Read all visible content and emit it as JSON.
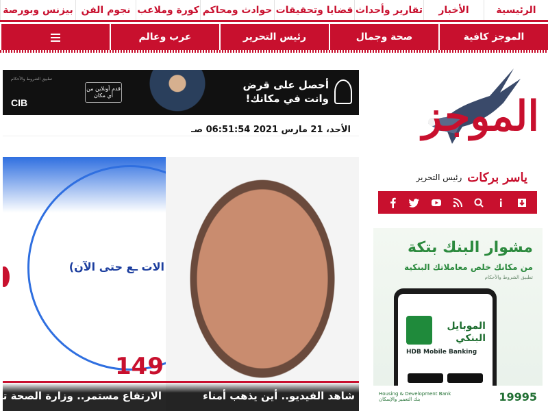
{
  "nav": {
    "row1": [
      {
        "label": "الرئيسية"
      },
      {
        "label": "الأخبار"
      },
      {
        "label": "تقارير وأحداث"
      },
      {
        "label": "قضايا وتحقيقات"
      },
      {
        "label": "حوادث ومحاكم"
      },
      {
        "label": "كورة وملاعب"
      },
      {
        "label": "نجوم الفن"
      },
      {
        "label": "بيزنس وبورصة"
      }
    ],
    "row2": [
      {
        "label": "الموجز كافية"
      },
      {
        "label": "صحة وجمال"
      },
      {
        "label": "رئيس التحرير"
      },
      {
        "label": "عرب وعالم"
      },
      {
        "label": ""
      }
    ]
  },
  "brand": {
    "logo_text": "الموجز",
    "editor_label": "رئيس التحرير",
    "editor_name": "ياسر بركات",
    "accent_color": "#c8102e"
  },
  "social": {
    "icons": [
      "archive-icon",
      "info-icon",
      "search-icon",
      "rss-icon",
      "youtube-icon",
      "twitter-icon",
      "facebook-icon"
    ]
  },
  "banner_cib": {
    "headline_line1": "أحصل على قرض",
    "headline_line2": "وانت في مكانك!",
    "online_badge": "قدم أونلاين من أي مكان",
    "brand": "CIB",
    "small_text": "تطبيق الشروط والأحكام"
  },
  "date_text": "الأحد، 21 مارس 2021 06:51:54 صـ",
  "cards": [
    {
      "caption": "الارتفاع مستمر.. وزارة الصحة تعلن",
      "infographic_number": "149",
      "infographic_text": "الات ـع حتى الآن)"
    },
    {
      "caption": "شاهد الفيديو.. أين يذهب أمناء"
    }
  ],
  "bank_ad": {
    "headline": "مشوار البنك بتكة",
    "subline": "من مكانك خلص معاملاتك البنكية",
    "tiny": "تطبيق الشروط والأحكام",
    "phone_title_1": "الموبايل",
    "phone_title_2": "البنكي",
    "phone_caption": "HDB Mobile Banking",
    "bank_name_en": "Housing & Development Bank",
    "bank_name_ar": "بنك التعمير والإسكان",
    "hotline": "19995",
    "brand_color": "#2c8a3e"
  }
}
